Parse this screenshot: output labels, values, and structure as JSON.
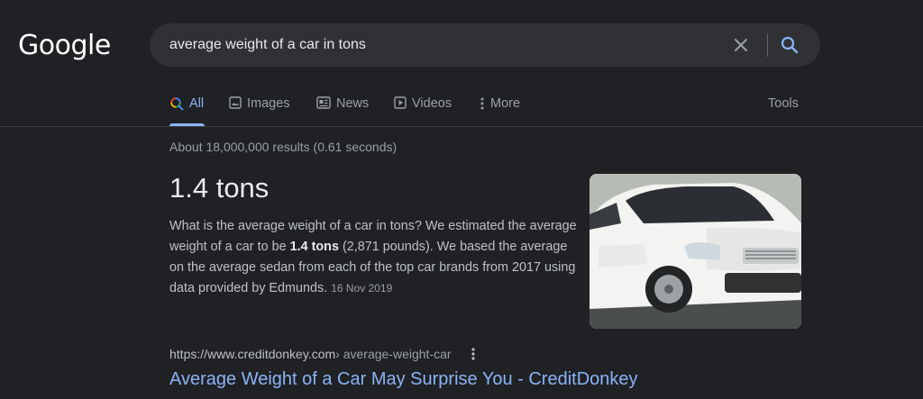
{
  "logo": {
    "text": "Google"
  },
  "search": {
    "query": "average weight of a car in tons"
  },
  "tabs": [
    {
      "label": "All",
      "icon": "search-icon",
      "active": true
    },
    {
      "label": "Images",
      "icon": "image-icon",
      "active": false
    },
    {
      "label": "News",
      "icon": "news-icon",
      "active": false
    },
    {
      "label": "Videos",
      "icon": "play-icon",
      "active": false
    },
    {
      "label": "More",
      "icon": "more-vert-icon",
      "active": false
    }
  ],
  "tools_label": "Tools",
  "stats": "About 18,000,000 results (0.61 seconds)",
  "featured": {
    "answer": "1.4 tons",
    "snippet_part1": "What is the average weight of a car in tons? We estimated the average weight of a car to be ",
    "snippet_bold": "1.4 tons",
    "snippet_part2": " (2,871 pounds). We based the average on the average sedan from each of the top car brands from 2017 using data provided by Edmunds.",
    "date": "16 Nov 2019",
    "image": "white-sedan-photo"
  },
  "result": {
    "domain": "https://www.creditdonkey.com",
    "path": " › average-weight-car",
    "title": "Average Weight of a Car May Surprise You - CreditDonkey"
  },
  "colors": {
    "background": "#202124",
    "accent": "#8ab4f8",
    "text": "#bdc1c6",
    "muted": "#9aa0a6"
  }
}
